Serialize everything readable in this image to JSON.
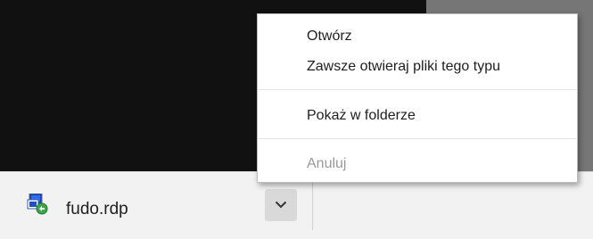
{
  "download_shelf": {
    "item": {
      "file_name": "fudo.rdp",
      "file_icon": "remote-desktop-file-icon",
      "dropdown_icon": "chevron-down-icon"
    }
  },
  "context_menu": {
    "items": [
      {
        "label": "Otwórz",
        "enabled": true
      },
      {
        "label": "Zawsze otwieraj pliki tego typu",
        "enabled": true
      },
      {
        "label": "Pokaż w folderze",
        "enabled": true
      },
      {
        "label": "Anuluj",
        "enabled": false
      }
    ]
  },
  "colors": {
    "page_dark": "#111111",
    "page_gray": "#767676",
    "shelf_bg": "#f2f2f2",
    "disabled_text": "#9a9a9a"
  }
}
